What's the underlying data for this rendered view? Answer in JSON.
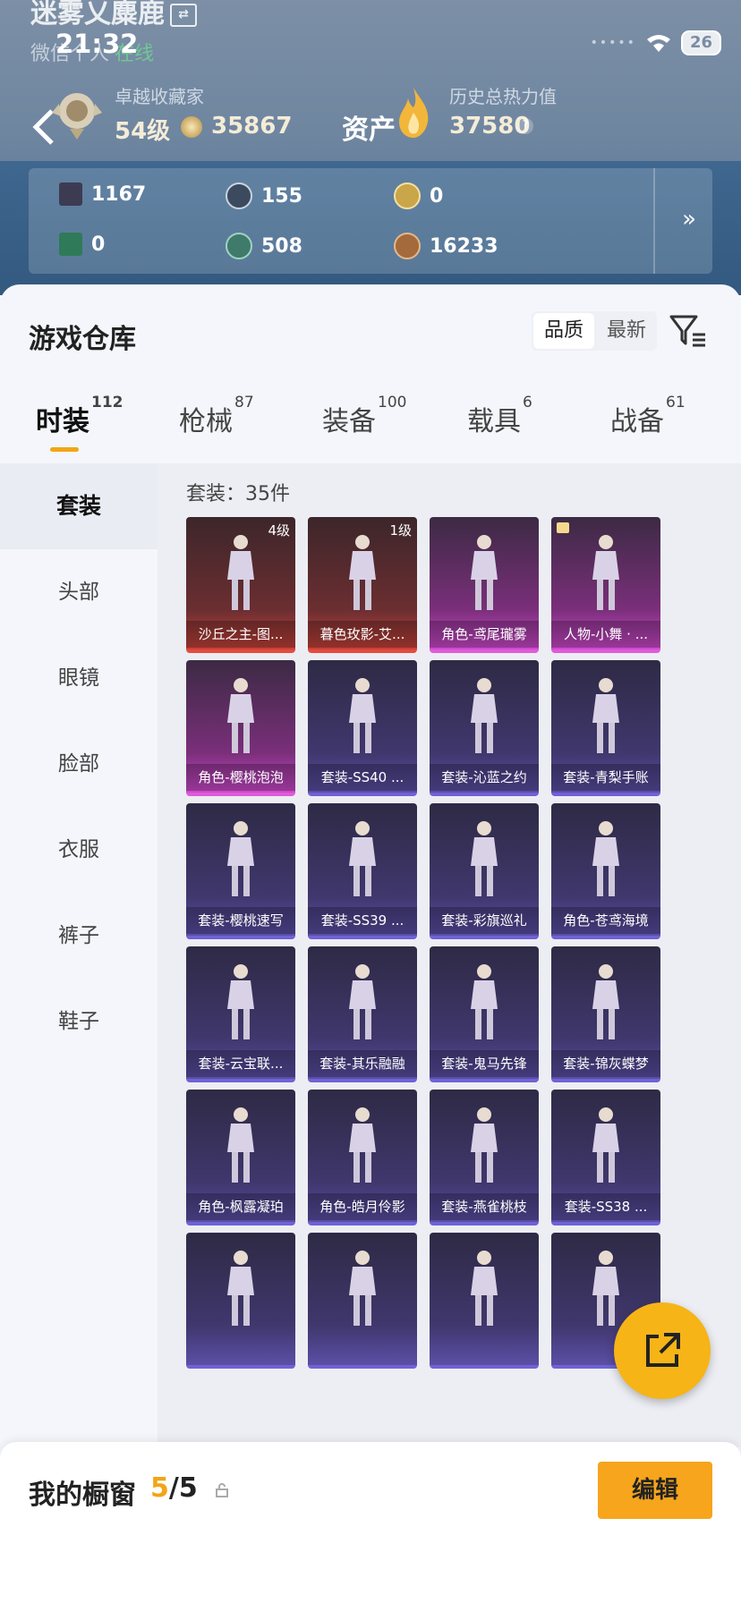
{
  "status_bar": {
    "time": "21:32",
    "battery": "26"
  },
  "profile": {
    "nickname": "迷雾乂麋鹿",
    "sub_label": "微信个人",
    "sub_status": "在线",
    "rank_title": "卓越收藏家",
    "rank_level": "54级",
    "coin_value": "35867",
    "asset_label": "资产",
    "heat_label": "历史总热力值",
    "heat_value": "37580",
    "heat_help": "?"
  },
  "currencies": [
    {
      "icon": "card-icon",
      "value": "1167",
      "color": "#3d3b52"
    },
    {
      "icon": "silver-coin-icon",
      "value": "155",
      "color": "#3b4a5e"
    },
    {
      "icon": "gold-coin-icon",
      "value": "0",
      "color": "#c9a64a"
    },
    {
      "icon": "green-card-icon",
      "value": "0",
      "color": "#2f7a58"
    },
    {
      "icon": "green-coin-icon",
      "value": "508",
      "color": "#3f7a6a"
    },
    {
      "icon": "bronze-coin-icon",
      "value": "16233",
      "color": "#a56a3c"
    }
  ],
  "currency_more": "»",
  "warehouse": {
    "title": "游戏仓库",
    "sort_options": [
      "品质",
      "最新"
    ],
    "active_sort": "品质"
  },
  "tabs": [
    {
      "label": "时装",
      "count": "112"
    },
    {
      "label": "枪械",
      "count": "87"
    },
    {
      "label": "装备",
      "count": "100"
    },
    {
      "label": "载具",
      "count": "6"
    },
    {
      "label": "战备",
      "count": "61"
    }
  ],
  "sidebar": [
    "套装",
    "头部",
    "眼镜",
    "脸部",
    "衣服",
    "裤子",
    "鞋子"
  ],
  "content": {
    "count_label": "套装：35件",
    "cards": [
      {
        "name": "沙丘之主-图...",
        "level": "4级",
        "rarity": "red"
      },
      {
        "name": "暮色玫影-艾...",
        "level": "1级",
        "rarity": "red"
      },
      {
        "name": "角色-鸢尾瓏雾",
        "level": "",
        "rarity": "pink"
      },
      {
        "name": "人物-小舞 · ...",
        "level": "",
        "rarity": "pink",
        "tag": true
      },
      {
        "name": "角色-樱桃泡泡",
        "level": "",
        "rarity": "pink"
      },
      {
        "name": "套装-SS40 ...",
        "level": "",
        "rarity": "purple"
      },
      {
        "name": "套装-沁蓝之约",
        "level": "",
        "rarity": "purple"
      },
      {
        "name": "套装-青梨手账",
        "level": "",
        "rarity": "purple"
      },
      {
        "name": "套装-樱桃速写",
        "level": "",
        "rarity": "purple"
      },
      {
        "name": "套装-SS39 ...",
        "level": "",
        "rarity": "purple"
      },
      {
        "name": "套装-彩旗巡礼",
        "level": "",
        "rarity": "purple"
      },
      {
        "name": "角色-苍鸢海境",
        "level": "",
        "rarity": "purple"
      },
      {
        "name": "套装-云宝联...",
        "level": "",
        "rarity": "purple"
      },
      {
        "name": "套装-其乐融融",
        "level": "",
        "rarity": "purple"
      },
      {
        "name": "套装-鬼马先锋",
        "level": "",
        "rarity": "purple"
      },
      {
        "name": "套装-锦灰蝶梦",
        "level": "",
        "rarity": "purple"
      },
      {
        "name": "角色-枫露凝珀",
        "level": "",
        "rarity": "purple"
      },
      {
        "name": "角色-皓月伶影",
        "level": "",
        "rarity": "purple"
      },
      {
        "name": "套装-燕雀桃枝",
        "level": "",
        "rarity": "purple"
      },
      {
        "name": "套装-SS38 ...",
        "level": "",
        "rarity": "purple"
      },
      {
        "name": "",
        "level": "",
        "rarity": "purple"
      },
      {
        "name": "",
        "level": "",
        "rarity": "purple"
      },
      {
        "name": "",
        "level": "",
        "rarity": "purple"
      },
      {
        "name": "",
        "level": "",
        "rarity": "purple"
      }
    ]
  },
  "showcase": {
    "label": "我的橱窗",
    "current": "5",
    "total": "/5",
    "edit_label": "编辑"
  }
}
